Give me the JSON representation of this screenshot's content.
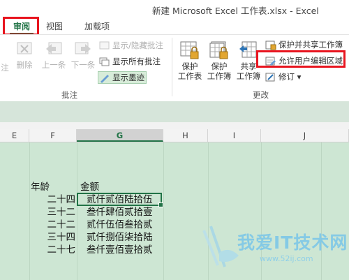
{
  "window": {
    "title": "新建 Microsoft Excel 工作表.xlsx - Excel"
  },
  "tabs": [
    {
      "label": "审阅",
      "active": true
    },
    {
      "label": "视图"
    },
    {
      "label": "加载项"
    }
  ],
  "ribbon": {
    "comments_group": {
      "label": "批注",
      "buttons": [
        {
          "label": "注",
          "icon": "new-comment-icon",
          "enabled": false
        },
        {
          "label": "删除",
          "icon": "delete-comment-icon",
          "enabled": false
        },
        {
          "label": "上一条",
          "icon": "previous-comment-icon",
          "enabled": false
        },
        {
          "label": "下一条",
          "icon": "next-comment-icon",
          "enabled": false
        }
      ],
      "small": [
        {
          "label": "显示/隐藏批注",
          "icon": "show-hide-comment-icon",
          "enabled": false
        },
        {
          "label": "显示所有批注",
          "icon": "show-all-comments-icon",
          "enabled": true
        },
        {
          "label": "显示墨迹",
          "icon": "show-ink-icon",
          "enabled": true,
          "highlighted": true
        }
      ]
    },
    "changes_group": {
      "label": "更改",
      "buttons": [
        {
          "label1": "保护",
          "label2": "工作表",
          "icon": "protect-sheet-icon"
        },
        {
          "label1": "保护",
          "label2": "工作簿",
          "icon": "protect-workbook-icon"
        },
        {
          "label1": "共享",
          "label2": "工作簿",
          "icon": "share-workbook-icon"
        }
      ],
      "small": [
        {
          "label": "保护并共享工作簿",
          "icon": "protect-share-icon"
        },
        {
          "label": "允许用户编辑区域",
          "icon": "allow-edit-ranges-icon"
        },
        {
          "label": "修订 ▾",
          "icon": "track-changes-icon"
        }
      ]
    }
  },
  "columns": [
    {
      "label": "E",
      "selected": false
    },
    {
      "label": "F",
      "selected": false
    },
    {
      "label": "G",
      "selected": true
    },
    {
      "label": "H",
      "selected": false
    },
    {
      "label": "I",
      "selected": false
    },
    {
      "label": "J",
      "selected": false
    }
  ],
  "sheet": {
    "headers": {
      "age": "年龄",
      "amount": "金额"
    },
    "rows": [
      {
        "age": "二十四",
        "amount": "贰仟贰佰陆拾伍"
      },
      {
        "age": "三十二",
        "amount": "叁仟肆佰贰拾壹"
      },
      {
        "age": "二十二",
        "amount": "贰仟伍佰叁拾贰"
      },
      {
        "age": "三十四",
        "amount": "贰仟捌佰柒拾陆"
      },
      {
        "age": "二十七",
        "amount": "叁仟壹佰壹拾贰"
      }
    ]
  },
  "watermark": {
    "title": "我爱IT技术网",
    "url": "www.52ij.com"
  },
  "colors": {
    "accent": "#217346",
    "highlight": "#e8151f",
    "sheet_bg": "#cde6d3"
  }
}
